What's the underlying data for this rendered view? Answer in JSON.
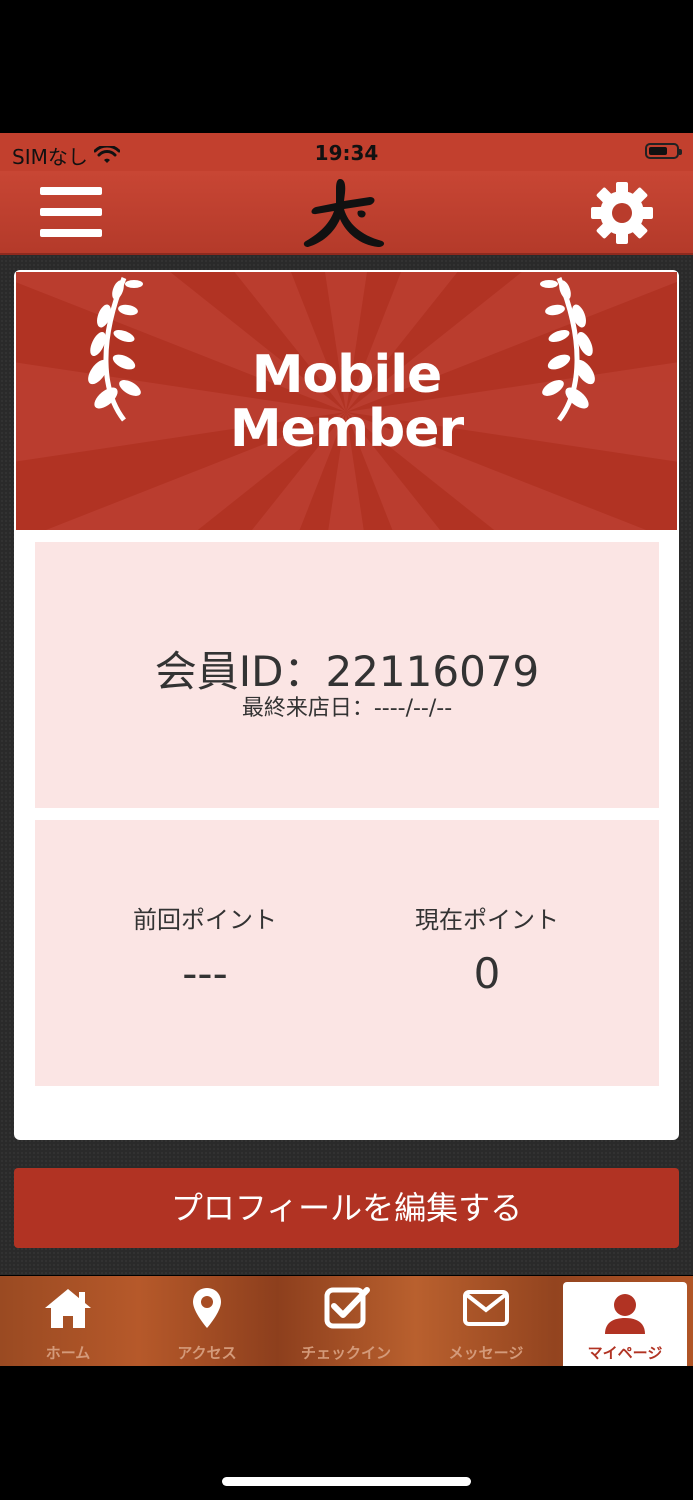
{
  "status_bar": {
    "carrier": "SIMなし",
    "time": "19:34"
  },
  "banner": {
    "line1": "Mobile",
    "line2": "Member"
  },
  "member": {
    "id_text": "会員ID：22116079",
    "last_visit_text": "最終来店日：----/--/--"
  },
  "points": {
    "previous_label": "前回ポイント",
    "previous_value": "---",
    "current_label": "現在ポイント",
    "current_value": "0"
  },
  "edit_profile_label": "プロフィールを編集する",
  "tabs": [
    {
      "label": "ホーム",
      "icon": "home-icon"
    },
    {
      "label": "アクセス",
      "icon": "map-pin-icon"
    },
    {
      "label": "チェックイン",
      "icon": "checkbox-icon"
    },
    {
      "label": "メッセージ",
      "icon": "envelope-icon"
    },
    {
      "label": "マイページ",
      "icon": "user-icon",
      "active": true
    }
  ],
  "colors": {
    "brand_red": "#b13323",
    "panel_pink": "#fbe5e4",
    "header_red": "#c2402e"
  }
}
